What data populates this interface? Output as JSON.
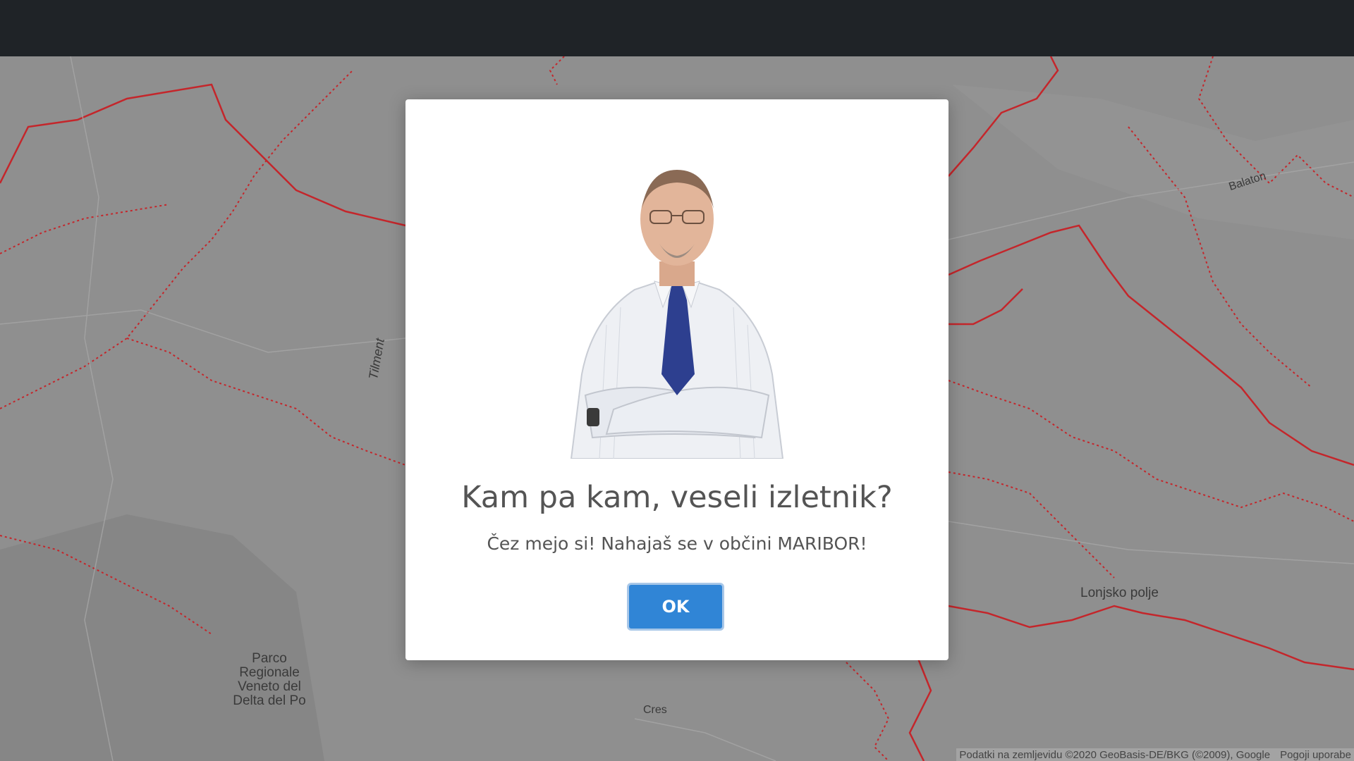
{
  "map": {
    "labels": {
      "tilment": "Tilment",
      "balaton": "Balaton",
      "lonjsko": "Lonjsko polje",
      "parco_line1": "Parco",
      "parco_line2": "Regionale",
      "parco_line3": "Veneto del",
      "parco_line4": "Delta del Po",
      "cres": "Cres"
    },
    "attribution": "Podatki na zemljevidu ©2020 GeoBasis-DE/BKG (©2009), Google",
    "terms_link": "Pogoji uporabe",
    "colors": {
      "border": "#c4262b",
      "base": "#8f8f8f"
    }
  },
  "modal": {
    "title": "Kam pa kam, veseli izletnik?",
    "message": "Čez mejo si! Nahajaš se v občini MARIBOR!",
    "ok_label": "OK",
    "ok_color": "#3085d6"
  }
}
